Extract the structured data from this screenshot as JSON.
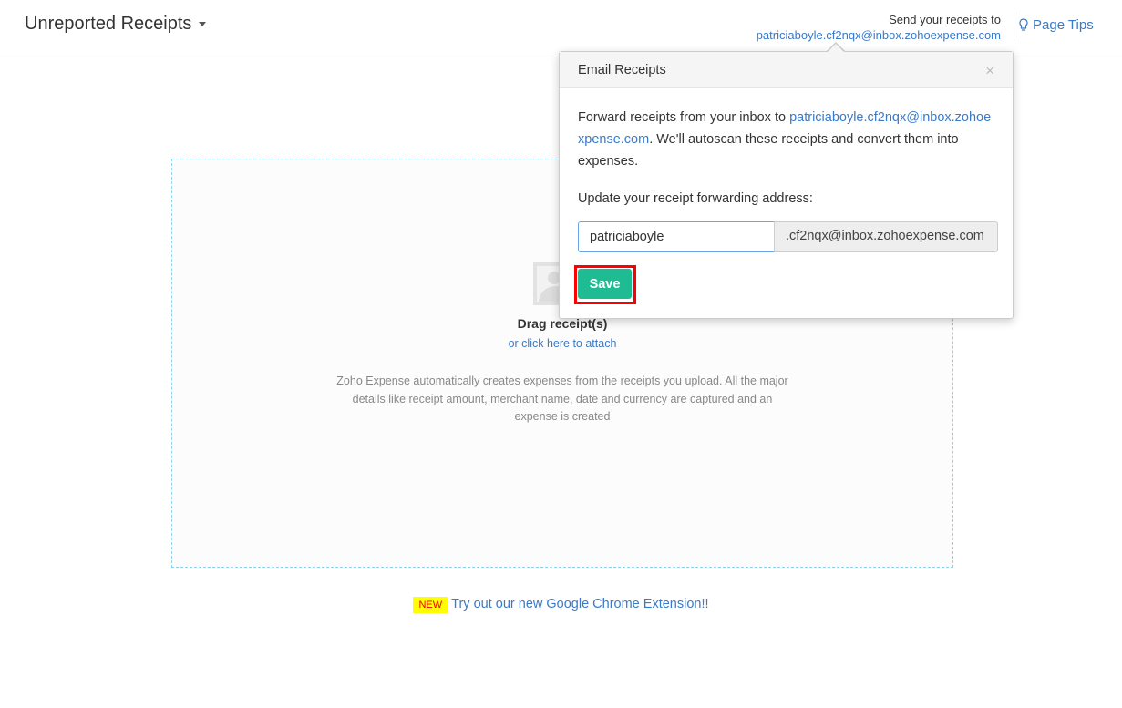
{
  "header": {
    "title": "Unreported Receipts",
    "send_label": "Send your receipts to",
    "send_email": "patriciaboyle.cf2nqx@inbox.zohoexpense.com",
    "page_tips": "Page Tips"
  },
  "dropzone": {
    "title": "Drag receipt(s)",
    "attach_link": "or click here to attach",
    "description": "Zoho Expense automatically creates expenses from the receipts you upload. All the major details like receipt amount, merchant name, date and currency are captured and an expense is created"
  },
  "promo": {
    "badge": "NEW",
    "link": "Try out our new Google Chrome Extension!!"
  },
  "popover": {
    "title": "Email Receipts",
    "close": "×",
    "body_prefix": "Forward receipts from your inbox to ",
    "body_email": "patriciaboyle.cf2nqx@inbox.zohoexpense.com",
    "body_suffix": ". We'll autoscan these receipts and convert them into expenses.",
    "update_label": "Update your receipt forwarding address:",
    "input_value": "patriciaboyle",
    "addon": ".cf2nqx@inbox.zohoexpense.com",
    "save": "Save"
  }
}
